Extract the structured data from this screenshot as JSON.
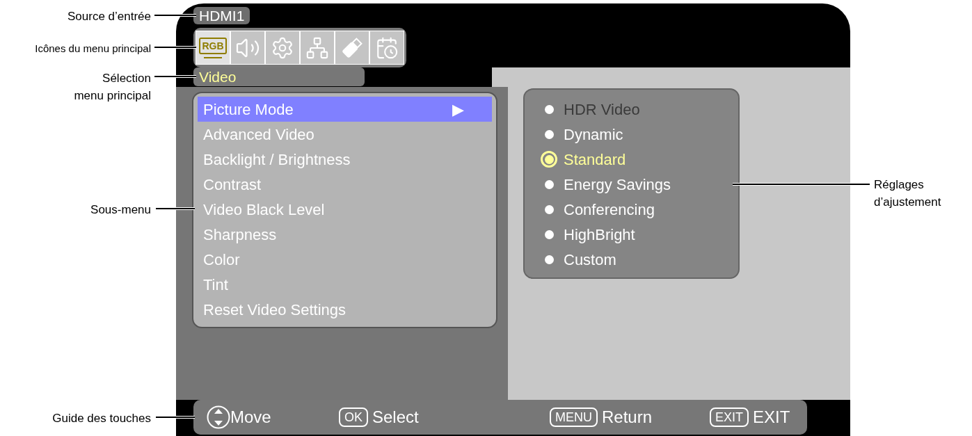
{
  "annotations": {
    "input_source": "Source d’entrée",
    "main_menu_icons": "Icônes du menu principal",
    "main_menu_selection": [
      "Sélection",
      "menu principal"
    ],
    "submenu": "Sous-menu",
    "key_guide": "Guide des touches",
    "adjustment_settings": [
      "Réglages",
      "d’ajustement"
    ]
  },
  "input_source": "HDMI1",
  "main_menu_icons": [
    {
      "kind": "picture",
      "label": "RGB",
      "selected": true
    },
    {
      "kind": "audio",
      "selected": false
    },
    {
      "kind": "setup",
      "selected": false
    },
    {
      "kind": "network",
      "selected": false
    },
    {
      "kind": "usb",
      "selected": false
    },
    {
      "kind": "schedule",
      "selected": false
    }
  ],
  "main_menu_selection": "Video",
  "submenu": [
    {
      "label": "Picture Mode",
      "selected": true,
      "arrow": "▶"
    },
    {
      "label": "Advanced Video",
      "selected": false
    },
    {
      "label": "Backlight / Brightness",
      "selected": false
    },
    {
      "label": "Contrast",
      "selected": false
    },
    {
      "label": "Video Black Level",
      "selected": false
    },
    {
      "label": "Sharpness",
      "selected": false
    },
    {
      "label": "Color",
      "selected": false
    },
    {
      "label": "Tint",
      "selected": false
    },
    {
      "label": "Reset Video Settings",
      "selected": false
    }
  ],
  "options": [
    {
      "label": "HDR Video",
      "selected": false,
      "disabled": true
    },
    {
      "label": "Dynamic",
      "selected": false,
      "disabled": false
    },
    {
      "label": "Standard",
      "selected": true,
      "disabled": false
    },
    {
      "label": "Energy Savings",
      "selected": false,
      "disabled": false
    },
    {
      "label": "Conferencing",
      "selected": false,
      "disabled": false
    },
    {
      "label": "HighBright",
      "selected": false,
      "disabled": false
    },
    {
      "label": "Custom",
      "selected": false,
      "disabled": false
    }
  ],
  "key_guide": [
    {
      "kind": "dpad",
      "label": "Move"
    },
    {
      "kind": "key",
      "key": "OK",
      "label": "Select"
    },
    {
      "kind": "key",
      "key": "MENU",
      "label": "Return"
    },
    {
      "kind": "key",
      "key": "EXIT",
      "label": "EXIT"
    }
  ]
}
